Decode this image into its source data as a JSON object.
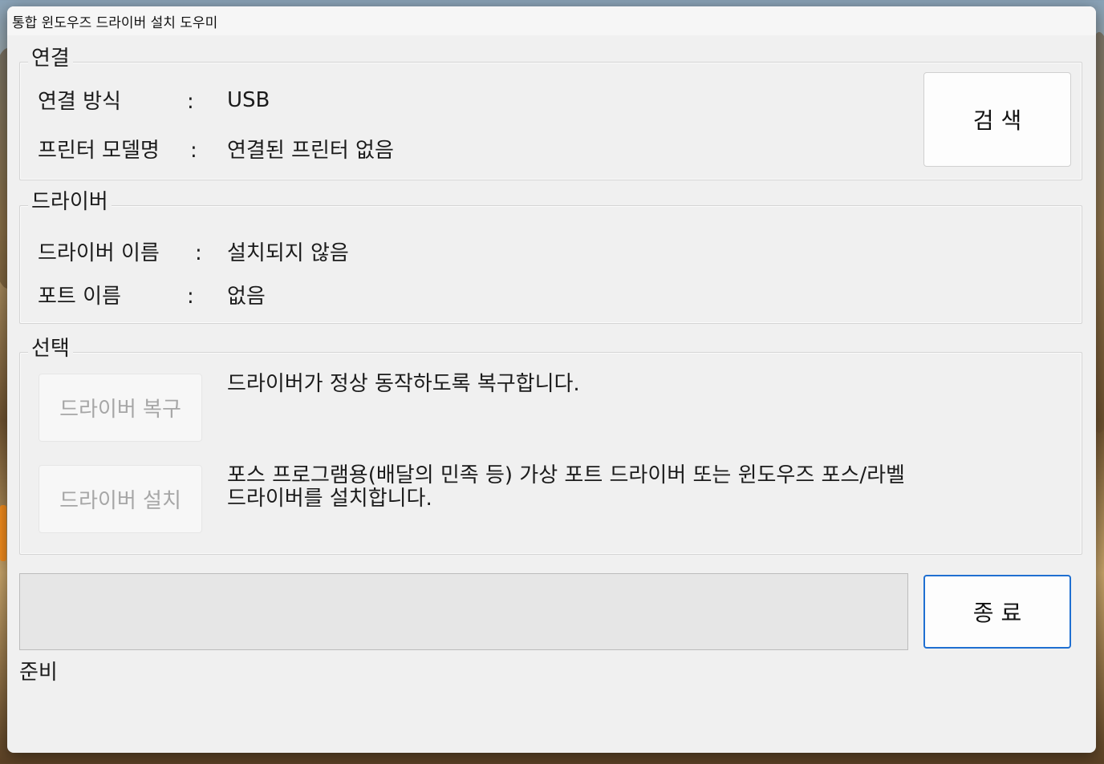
{
  "window": {
    "title": "통합 윈도우즈 드라이버 설치 도우미"
  },
  "connection": {
    "legend": "연결",
    "method_label": "연결 방식",
    "method_colon": ":",
    "method_value": "USB",
    "model_label": "프린터 모델명",
    "model_colon": ":",
    "model_value": "연결된 프린터 없음",
    "search_button": "검  색"
  },
  "driver": {
    "legend": "드라이버",
    "name_label": "드라이버 이름",
    "name_colon": ":",
    "name_value": "설치되지 않음",
    "port_label": "포트 이름",
    "port_colon": ":",
    "port_value": "없음"
  },
  "selection": {
    "legend": "선택",
    "repair_button": "드라이버 복구",
    "repair_desc": "드라이버가 정상 동작하도록 복구합니다.",
    "install_button": "드라이버 설치",
    "install_desc_line1": "포스 프로그램용(배달의 민족 등) 가상 포트 드라이버 또는 윈도우즈 포스/라벨",
    "install_desc_line2": "드라이버를 설치합니다."
  },
  "footer": {
    "progress_value": 0,
    "exit_button": "종  료",
    "status": "준비"
  },
  "colors": {
    "window_bg": "#f0f0f0",
    "accent_border": "#1f6fd1",
    "disabled_text": "#a6a6a6"
  }
}
